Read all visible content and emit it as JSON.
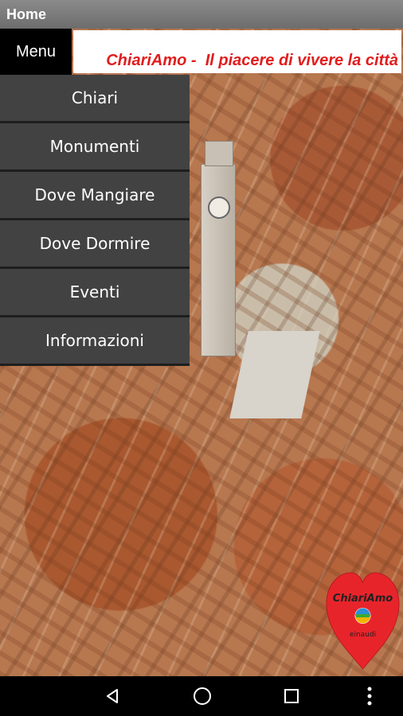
{
  "title_bar": {
    "title": "Home"
  },
  "header": {
    "menu_label": "Menu",
    "banner_text": "ChiariAmo -  Il piacere di vivere la città"
  },
  "drawer": {
    "items": [
      {
        "label": "Chiari"
      },
      {
        "label": "Monumenti"
      },
      {
        "label": "Dove Mangiare"
      },
      {
        "label": "Dove Dormire"
      },
      {
        "label": "Eventi"
      },
      {
        "label": "Informazioni"
      }
    ]
  },
  "logo": {
    "name": "ChiariAmo",
    "sub": "einaudi",
    "heart_color": "#e8242b"
  },
  "navbar": {
    "buttons": [
      "back-icon",
      "home-icon",
      "recents-icon",
      "more-vert-icon"
    ]
  },
  "colors": {
    "banner_text": "#e11d1d",
    "drawer_bg": "#424242",
    "title_bar": "#7a7a7a"
  }
}
